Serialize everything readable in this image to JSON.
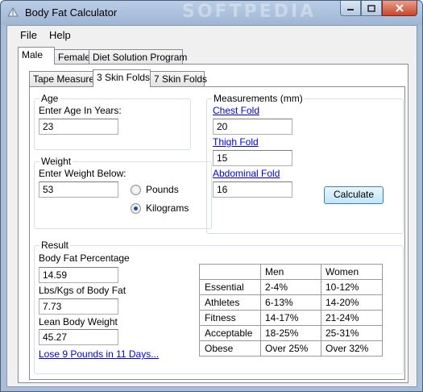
{
  "window": {
    "title": "Body Fat Calculator",
    "watermark": "SOFTPEDIA"
  },
  "menu": {
    "file": "File",
    "help": "Help"
  },
  "main_tabs": [
    {
      "label": "Male"
    },
    {
      "label": "Female"
    },
    {
      "label": "Diet Solution Program"
    }
  ],
  "sub_tabs": [
    {
      "label": "Tape Measure"
    },
    {
      "label": "3 Skin Folds"
    },
    {
      "label": "7 Skin Folds"
    }
  ],
  "age": {
    "group_title": "Age",
    "label": "Enter Age In Years:",
    "value": "23"
  },
  "weight": {
    "group_title": "Weight",
    "label": "Enter Weight Below:",
    "value": "53",
    "unit_options": [
      "Pounds",
      "Kilograms"
    ],
    "selected_unit": "Kilograms"
  },
  "measurements": {
    "group_title": "Measurements (mm)",
    "chest_label": "Chest Fold",
    "chest_value": "20",
    "thigh_label": "Thigh Fold",
    "thigh_value": "15",
    "abdominal_label": "Abdominal Fold",
    "abdominal_value": "16",
    "calculate_label": "Calculate"
  },
  "result": {
    "group_title": "Result",
    "body_fat_label": "Body Fat Percentage",
    "body_fat_value": "14.59",
    "fat_weight_label": "Lbs/Kgs of Body Fat",
    "fat_weight_value": "7.73",
    "lean_label": "Lean Body Weight",
    "lean_value": "45.27",
    "promo_link": "Lose 9 Pounds in 11 Days..."
  },
  "reference_table": {
    "headers": [
      "",
      "Men",
      "Women"
    ],
    "rows": [
      [
        "Essential",
        "2-4%",
        "10-12%"
      ],
      [
        "Athletes",
        "6-13%",
        "14-20%"
      ],
      [
        "Fitness",
        "14-17%",
        "21-24%"
      ],
      [
        "Acceptable",
        "18-25%",
        "25-31%"
      ],
      [
        "Obese",
        "Over 25%",
        "Over 32%"
      ]
    ]
  },
  "icons": [
    "calculator-app-icon",
    "minimize-icon",
    "maximize-icon",
    "close-icon"
  ]
}
